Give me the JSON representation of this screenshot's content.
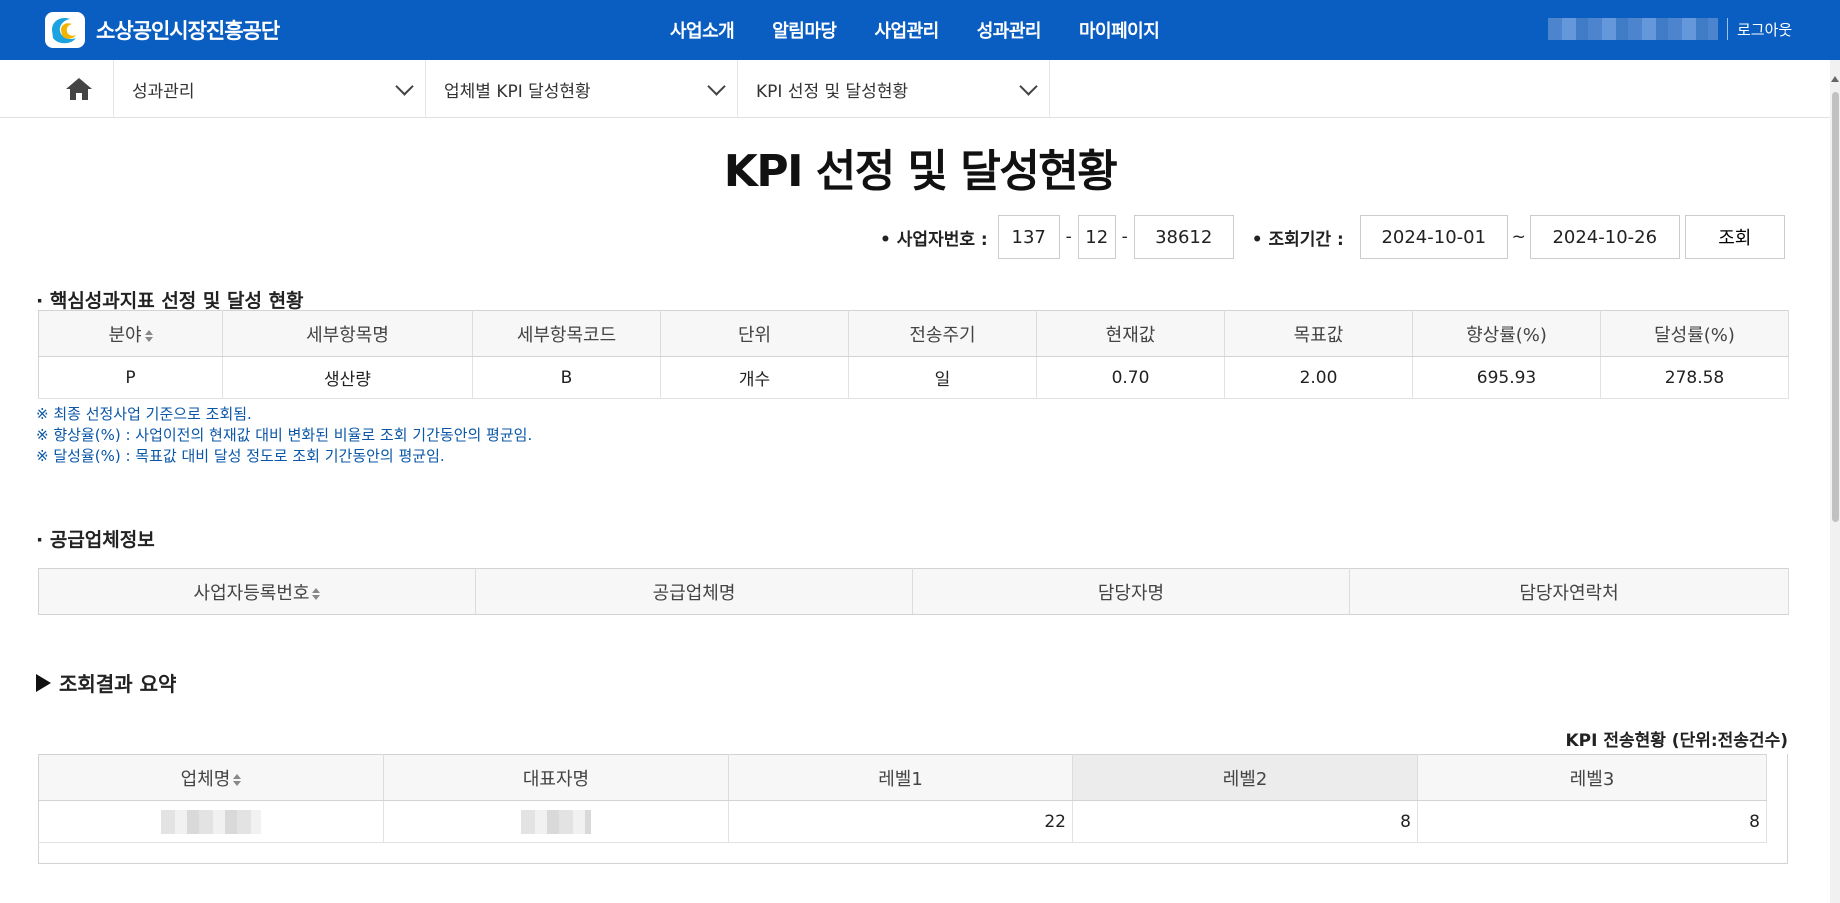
{
  "header": {
    "logo_text": "소상공인시장진흥공단",
    "nav": [
      "사업소개",
      "알림마당",
      "사업관리",
      "성과관리",
      "마이페이지"
    ],
    "logout": "로그아웃",
    "brand_color": "#0a5ec1"
  },
  "breadcrumb": {
    "items": [
      "성과관리",
      "업체별 KPI 달성현황",
      "KPI 선정 및 달성현황"
    ]
  },
  "page": {
    "title": "KPI 선정 및 달성현황"
  },
  "search": {
    "biz_label": "• 사업자번호 :",
    "biz_no_1": "137",
    "biz_no_2": "12",
    "biz_no_3": "38612",
    "period_label": "• 조회기간 :",
    "date_from": "2024-10-01",
    "tilde": "~",
    "date_to": "2024-10-26",
    "search_button": "조회"
  },
  "kpi_section": {
    "title": "· 핵심성과지표 선정 및 달성 현황",
    "headers": [
      "분야",
      "세부항목명",
      "세부항목코드",
      "단위",
      "전송주기",
      "현재값",
      "목표값",
      "향상률(%)",
      "달성률(%)"
    ],
    "rows": [
      [
        "P",
        "생산량",
        "B",
        "개수",
        "일",
        "0.70",
        "2.00",
        "695.93",
        "278.58"
      ]
    ],
    "notes": [
      "※ 최종 선정사업 기준으로 조회됨.",
      "※ 향상율(%) : 사업이전의 현재값 대비 변화된 비율로 조회 기간동안의 평균임.",
      "※ 달성율(%) : 목표값 대비 달성 정도로 조회 기간동안의 평균임."
    ]
  },
  "supplier_section": {
    "title": "· 공급업체정보",
    "headers": [
      "사업자등록번호",
      "공급업체명",
      "담당자명",
      "담당자연락처"
    ]
  },
  "summary_section": {
    "title": "조회결과 요약",
    "caption": "KPI 전송현황 (단위:전송건수)",
    "headers": [
      "업체명",
      "대표자명",
      "레벨1",
      "레벨2",
      "레벨3"
    ],
    "rows": [
      {
        "level1": "22",
        "level2": "8",
        "level3": "8"
      }
    ]
  }
}
